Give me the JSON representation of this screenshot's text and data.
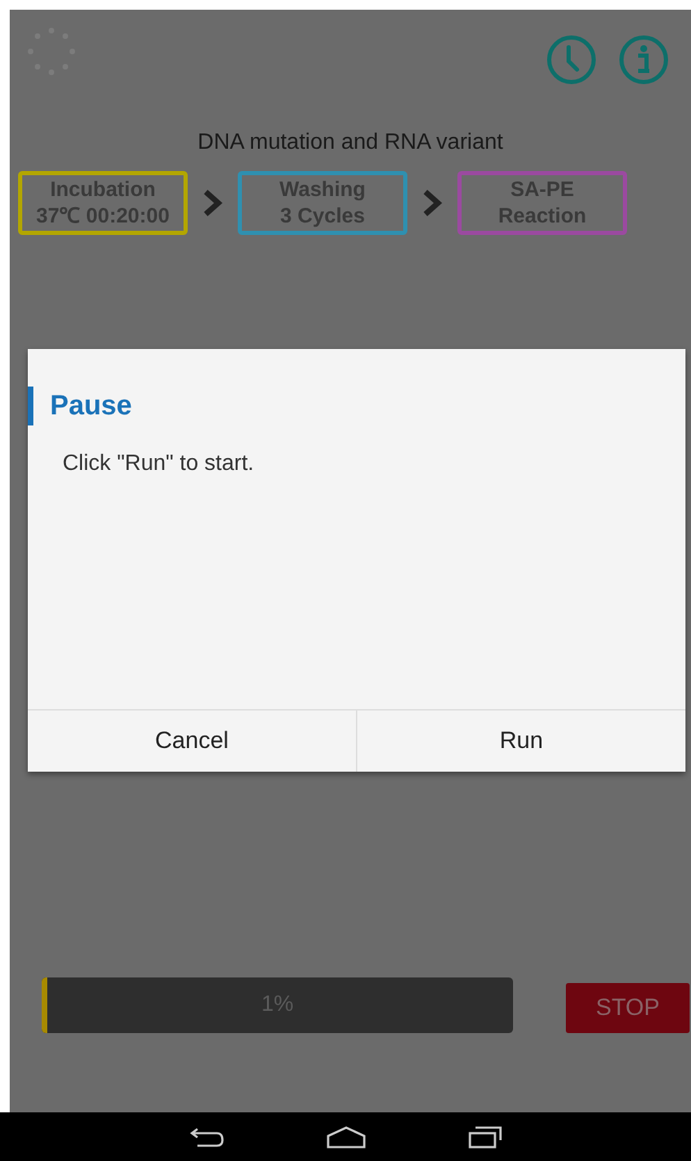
{
  "header": {
    "title": "DNA mutation and RNA variant"
  },
  "steps": [
    {
      "title": "Incubation",
      "detail": "37℃ 00:20:00",
      "color": "#b3a600"
    },
    {
      "title": "Washing",
      "detail": "3 Cycles",
      "color": "#2f90b0"
    },
    {
      "title": "SA-PE",
      "detail": "Reaction",
      "color": "#9b4aa0"
    }
  ],
  "progress": {
    "level": 0.01,
    "label": "1%"
  },
  "stop_button": "STOP",
  "dialog": {
    "title": "Pause",
    "message": "Click \"Run\" to start.",
    "buttons": [
      "Cancel",
      "Run"
    ]
  }
}
